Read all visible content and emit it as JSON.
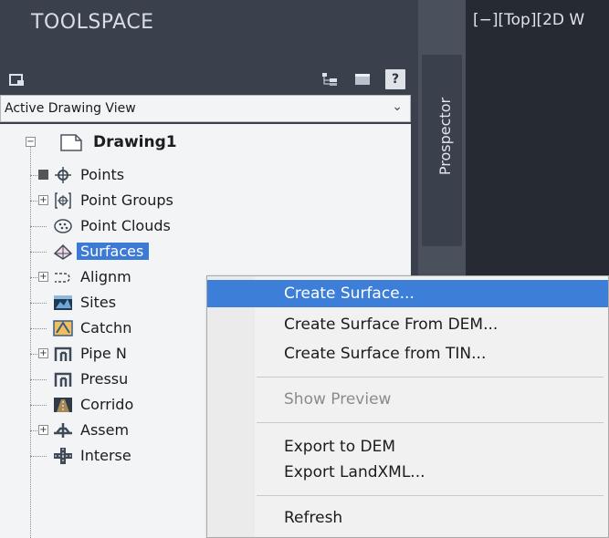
{
  "toolspace": {
    "title": "TOOLSPACE",
    "toolbar": {
      "btn1_icon": "layout-icon",
      "btn2_icon": "tree-view-icon",
      "btn3_icon": "item-view-icon",
      "help_label": "?"
    },
    "view_select": {
      "value": "Active Drawing View"
    },
    "tree": {
      "root": "Drawing1",
      "items": [
        {
          "label": "Points",
          "icon": "points-icon"
        },
        {
          "label": "Point Groups",
          "icon": "point-groups-icon"
        },
        {
          "label": "Point Clouds",
          "icon": "point-clouds-icon"
        },
        {
          "label": "Surfaces",
          "icon": "surfaces-icon"
        },
        {
          "label": "Alignm",
          "icon": "alignments-icon"
        },
        {
          "label": "Sites",
          "icon": "sites-icon"
        },
        {
          "label": "Catchn",
          "icon": "catchments-icon"
        },
        {
          "label": "Pipe N",
          "icon": "pipe-networks-icon"
        },
        {
          "label": "Pressu",
          "icon": "pressure-networks-icon"
        },
        {
          "label": "Corrido",
          "icon": "corridors-icon"
        },
        {
          "label": "Assem",
          "icon": "assemblies-icon"
        },
        {
          "label": "Interse",
          "icon": "intersections-icon"
        }
      ]
    }
  },
  "side_tab": {
    "label": "Prospector"
  },
  "viewport": {
    "label": "[−][Top][2D W"
  },
  "context_menu": {
    "items": [
      {
        "label": "Create Surface..."
      },
      {
        "label": "Create Surface From DEM..."
      },
      {
        "label": "Create Surface from TIN..."
      },
      {
        "label": "Show Preview"
      },
      {
        "label": "Export to DEM"
      },
      {
        "label": "Export LandXML..."
      },
      {
        "label": "Refresh"
      }
    ]
  },
  "colors": {
    "panel_bg": "#3b414c",
    "tree_bg": "#f3f4f6",
    "selection": "#3c7ad6",
    "viewport_bg": "#262b33"
  }
}
